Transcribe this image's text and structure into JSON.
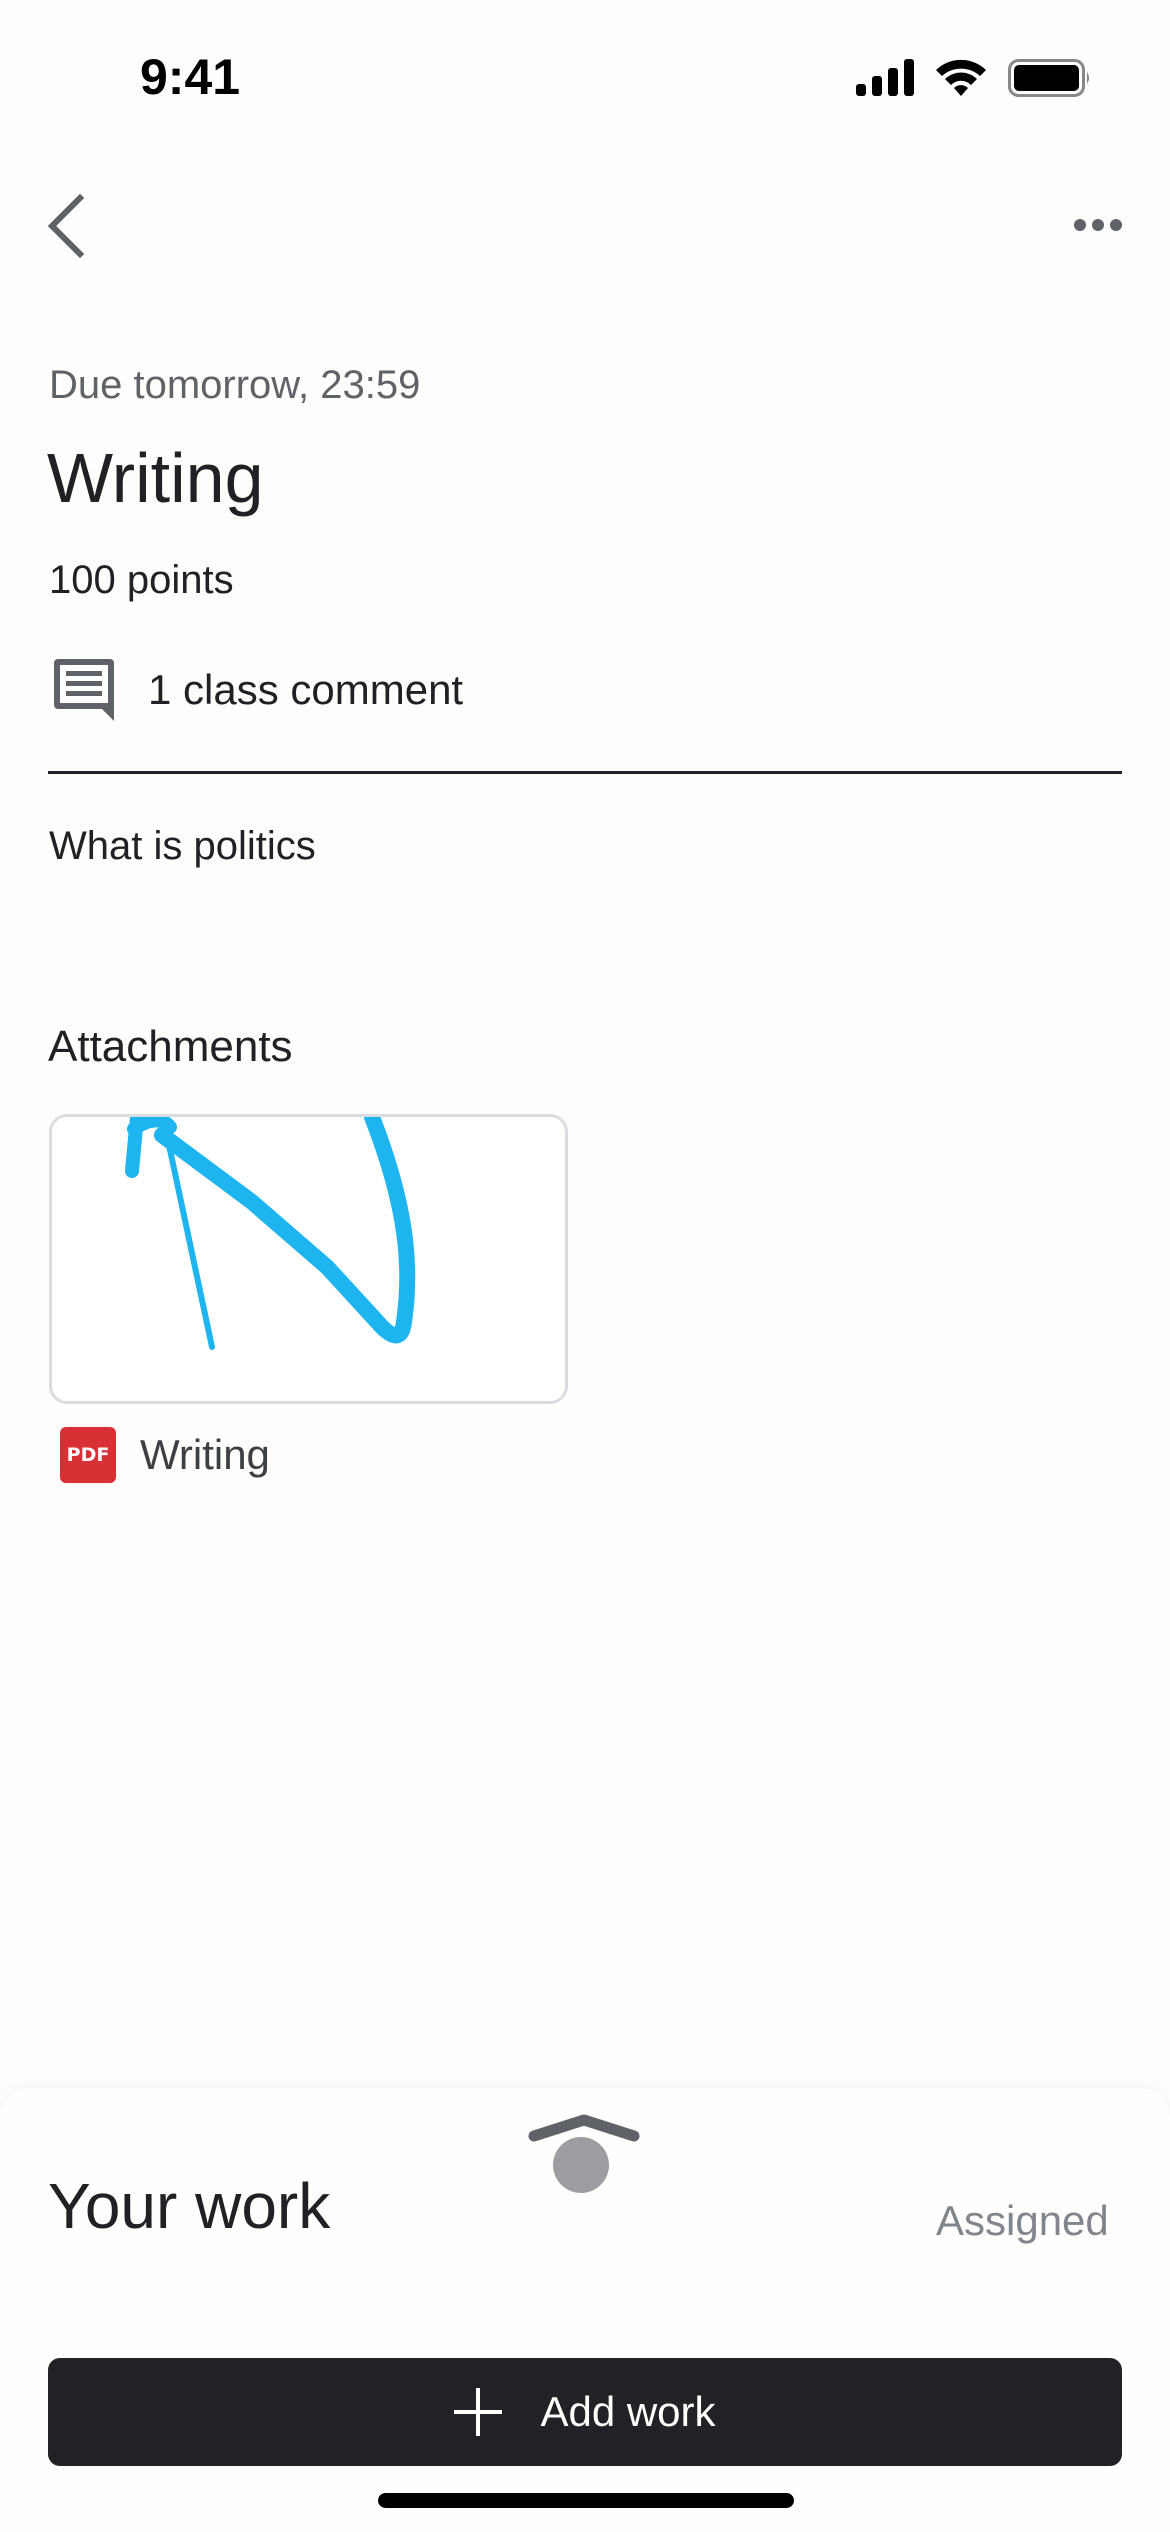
{
  "status_bar": {
    "time": "9:41",
    "icons": [
      "signal-icon",
      "wifi-icon",
      "battery-icon"
    ]
  },
  "nav": {
    "back_icon": "chevron-left-icon",
    "more_icon": "more-horizontal-icon"
  },
  "assignment": {
    "due": "Due tomorrow, 23:59",
    "title": "Writing",
    "points": "100 points",
    "comments_label": "1 class comment",
    "comments_icon": "comment-icon",
    "description": "What is politics"
  },
  "attachments": {
    "heading": "Attachments",
    "items": [
      {
        "name": "Writing",
        "type_badge": "PDF",
        "type_icon": "pdf-icon",
        "thumbnail_stroke_color": "#1eb4ef"
      }
    ]
  },
  "your_work": {
    "handle_icon": "chevron-up-icon",
    "title": "Your work",
    "status": "Assigned",
    "add_button_label": "Add work",
    "add_button_icon": "plus-icon"
  },
  "colors": {
    "pdf_red": "#d93036",
    "button_dark": "#222226",
    "secondary_text": "#5f6368"
  }
}
